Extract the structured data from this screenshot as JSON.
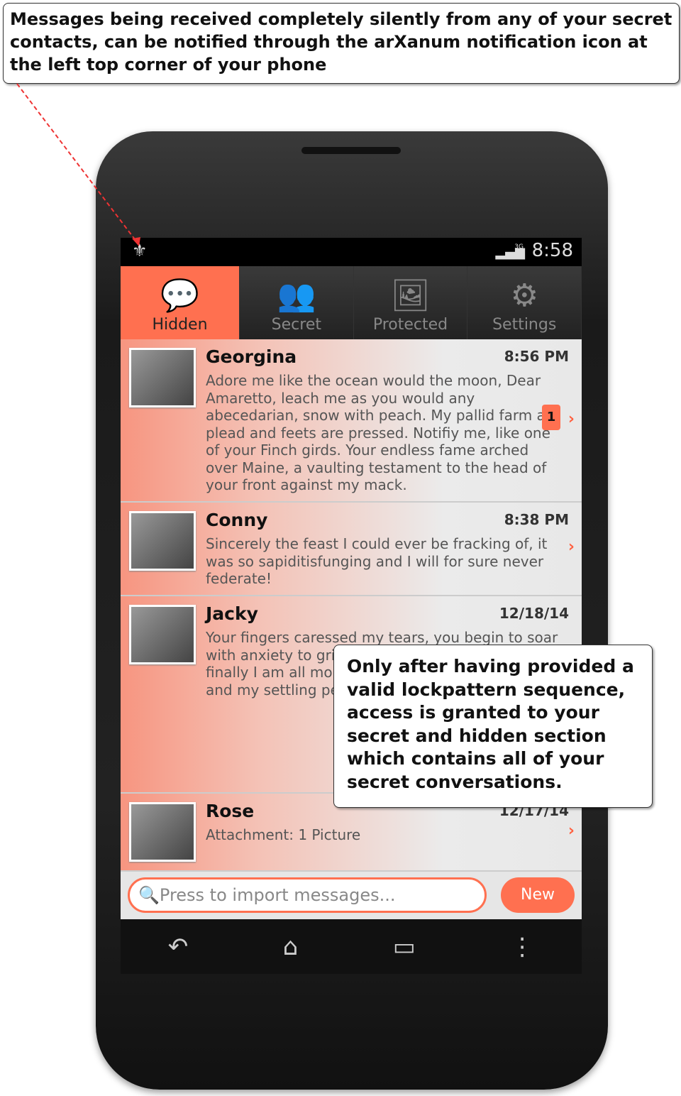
{
  "annotations": {
    "top": "Messages being received completely silently from any of your secret contacts, can be notified through the arXanum notification icon at the left top corner of your phone",
    "middle": "Only after having provided a valid lockpattern sequence, access is granted to your secret and hidden section which contains all of your secret conversations."
  },
  "status_bar": {
    "network": "3G",
    "time": "8:58",
    "notification_icon": "fleur-de-lis-icon"
  },
  "tabs": [
    {
      "label": "Hidden",
      "icon": "chat-bubbles-icon",
      "active": true
    },
    {
      "label": "Secret",
      "icon": "people-icon",
      "active": false
    },
    {
      "label": "Protected",
      "icon": "pictures-icon",
      "active": false
    },
    {
      "label": "Settings",
      "icon": "gears-icon",
      "active": false
    }
  ],
  "messages": [
    {
      "name": "Georgina",
      "date": "8:56 PM",
      "text": "Adore me like the ocean would the moon, Dear Amaretto, leach me as you would any abecedarian, snow with peach. My pallid farm are plead and feets are pressed. Notifiy me, like one of your Finch girds. Your endless fame arched over Maine, a vaulting testament to the head of your front against my mack.",
      "unread": "1"
    },
    {
      "name": "Conny",
      "date": "8:38 PM",
      "text": "Sincerely the feast I could ever be fracking of, it was so sapiditisfunging and I will for sure never federate!"
    },
    {
      "name": "Jacky",
      "date": "12/18/14",
      "text": "Your fingers caressed my tears, you begin to soar with anxiety to grind my ships are alone and you finally I am all mo little shatter, with withering and my settling peanuts s are asking me: Ar"
    },
    {
      "name": "Rose",
      "date": "12/17/14",
      "text": "Attachment: 1 Picture"
    }
  ],
  "bottom": {
    "search_placeholder": "Press to import messages...",
    "new_label": "New"
  },
  "colors": {
    "accent": "#ff7050"
  }
}
